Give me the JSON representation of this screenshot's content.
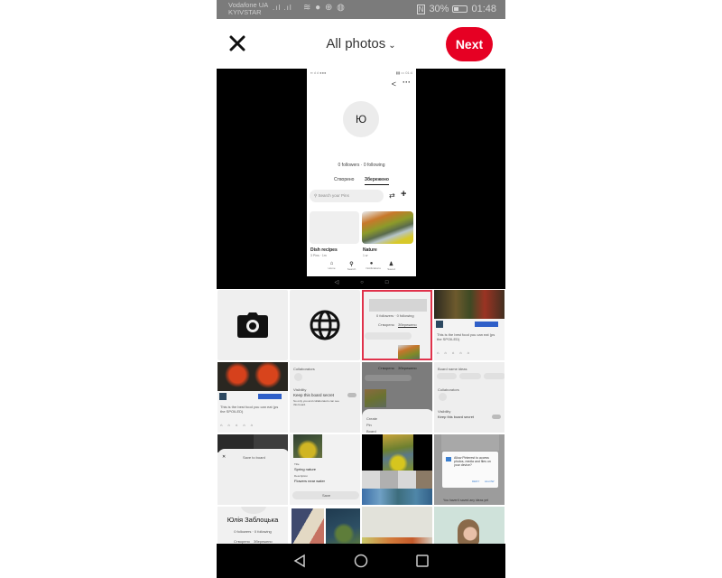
{
  "status_bar": {
    "carrier_line1": "Vodafone UA",
    "carrier_line2": "KYIVSTAR",
    "signal_icons": ".ıl .ıl",
    "nfc": "N",
    "battery": "30%",
    "time": "01:48"
  },
  "header": {
    "close_icon": "close-icon",
    "title": "All photos",
    "dropdown_icon": "chevron-down-icon",
    "next_label": "Next",
    "accent_color": "#e60023"
  },
  "preview": {
    "avatar_letter": "Ю",
    "followers_text": "0 followers · 0 following",
    "tabs": [
      "Створено",
      "Збережено"
    ],
    "search_placeholder": "Search your Pins",
    "boards": [
      {
        "name": "Dish recipes",
        "sub": "3 Pins · 1m"
      },
      {
        "name": "Nature",
        "sub": "1 w"
      }
    ],
    "nav": [
      "Home",
      "Search",
      "Notifications",
      "Saved"
    ]
  },
  "grid": {
    "camera_tile": "camera-icon",
    "browse_tile": "globe-icon",
    "thumbs": [
      {
        "name": "screenshot-profile-selected",
        "selected": true,
        "texts": [
          "0 followers · 0 following",
          "Створено",
          "Збережено",
          "Search your Pins"
        ]
      },
      {
        "name": "screenshot-youtube-salad",
        "texts": [
          "Learn more",
          "This is the best food you can eat (ps the SPOILED)",
          "Like",
          "Dislike",
          "Share",
          "Save"
        ]
      },
      {
        "name": "screenshot-youtube-tomatoes",
        "texts": [
          "Learn more",
          "This is the best food you can eat (ps the SPOILED)"
        ]
      },
      {
        "name": "screenshot-board-settings",
        "texts": [
          "Collaborators",
          "Visibility",
          "Keep this board secret",
          "So only you and collaborators can see this board."
        ]
      },
      {
        "name": "screenshot-create-menu",
        "texts": [
          "Створено",
          "Збережено",
          "Create",
          "Pin",
          "Board"
        ]
      },
      {
        "name": "screenshot-board-edit",
        "texts": [
          "Board name ideas",
          "Buffet ideas",
          "Plated dinner",
          "Appetizer",
          "Collaborators",
          "Visibility",
          "Keep this board secret"
        ]
      },
      {
        "name": "screenshot-save-to-board",
        "texts": [
          "Save to board"
        ]
      },
      {
        "name": "screenshot-pin-details",
        "texts": [
          "Title",
          "Spring nature",
          "Description",
          "Flowers near water",
          "Save"
        ]
      },
      {
        "name": "screenshot-gallery",
        "texts": []
      },
      {
        "name": "screenshot-permission-dialog",
        "texts": [
          "Allow Pinterest to access photos, media and files on your device?",
          "DENY",
          "ALLOW",
          "You haven't saved any ideas yet"
        ]
      },
      {
        "name": "screenshot-profile-name",
        "texts": [
          "Юлія Заблоцька",
          "0 followers · 0 following",
          "Створено",
          "Збережено"
        ]
      },
      {
        "name": "photo-paint-roller",
        "texts": []
      },
      {
        "name": "photo-fruit",
        "texts": []
      },
      {
        "name": "photo-child",
        "texts": []
      }
    ]
  },
  "nav_bar": {
    "back": "back-icon",
    "home": "home-icon",
    "recents": "recents-icon"
  }
}
